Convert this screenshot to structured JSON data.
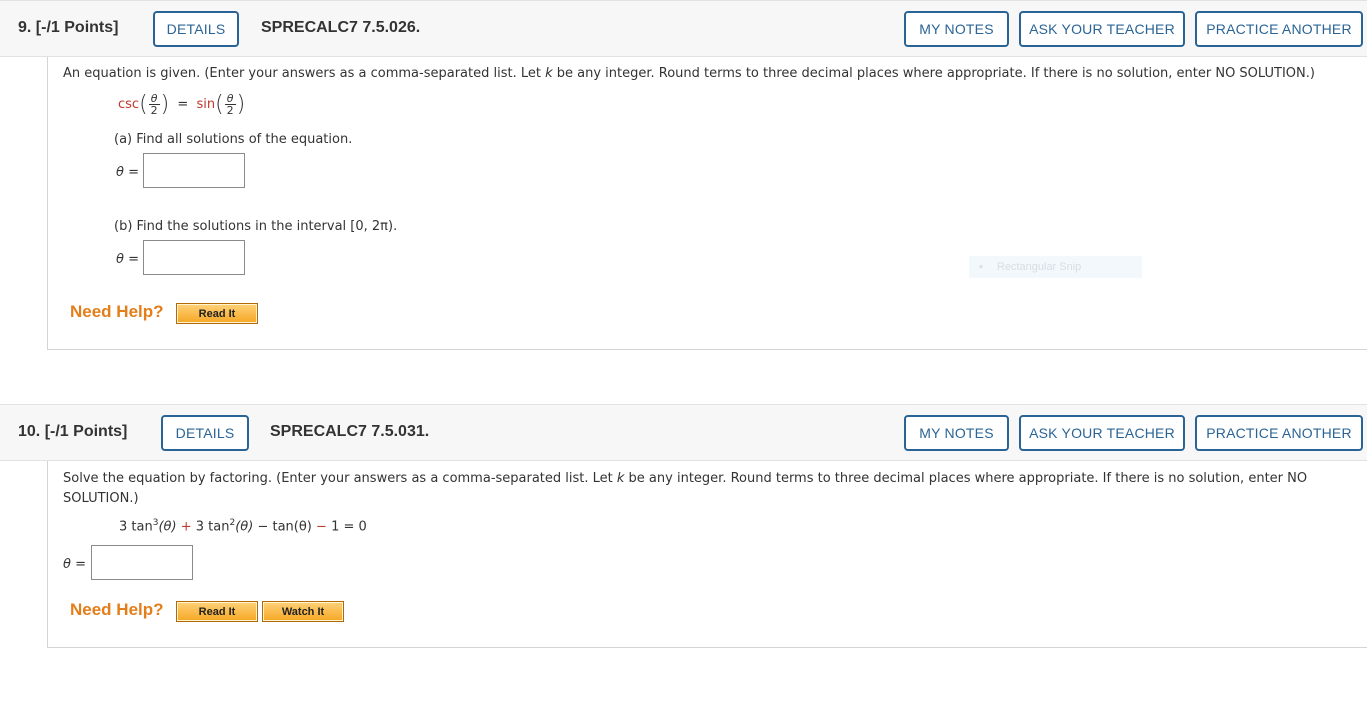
{
  "questions": [
    {
      "number": "9.",
      "points": "[-/1 Points]",
      "details_label": "DETAILS",
      "code": "SPRECALC7 7.5.026.",
      "buttons": {
        "my_notes": "MY NOTES",
        "ask_teacher": "ASK YOUR TEACHER",
        "practice": "PRACTICE ANOTHER"
      },
      "instructions_pre": "An equation is given. (Enter your answers as a comma-separated list. Let ",
      "instructions_var": "k",
      "instructions_post": " be any integer. Round terms to three decimal places where appropriate. If there is no solution, enter NO SOLUTION.)",
      "equation": {
        "left_fn": "csc",
        "right_fn": "sin",
        "equals": "=",
        "numerator": "θ",
        "denominator": "2"
      },
      "part_a": {
        "prompt": "(a) Find all solutions of the equation.",
        "label": "θ =",
        "value": ""
      },
      "part_b": {
        "prompt": "(b) Find the solutions in the interval [0, 2π).",
        "label": "θ =",
        "value": ""
      },
      "need_help": "Need Help?",
      "help_buttons": [
        "Read It"
      ]
    },
    {
      "number": "10.",
      "points": "[-/1 Points]",
      "details_label": "DETAILS",
      "code": "SPRECALC7 7.5.031.",
      "buttons": {
        "my_notes": "MY NOTES",
        "ask_teacher": "ASK YOUR TEACHER",
        "practice": "PRACTICE ANOTHER"
      },
      "instructions_line1_pre": "Solve the equation by factoring. (Enter your answers as a comma-separated list. Let ",
      "instructions_var": "k",
      "instructions_line1_post": " be any integer. Round terms to three decimal places where appropriate. If there is no solution, enter NO",
      "instructions_line2": "SOLUTION.)",
      "equation": {
        "t1_coef": "3 tan",
        "t1_exp": "3",
        "t1_arg": "(θ)",
        "plus": "+",
        "t2_coef": "3 tan",
        "t2_exp": "2",
        "t2_arg": "(θ)",
        "t3": "− tan(θ)",
        "minus": "−",
        "rhs": "1 = 0"
      },
      "answer": {
        "label": "θ =",
        "value": ""
      },
      "need_help": "Need Help?",
      "help_buttons": [
        "Read It",
        "Watch It"
      ]
    }
  ],
  "overlay_hint": "Rectangular Snip",
  "colors": {
    "accent": "#2a6496",
    "help_orange": "#e37e1a",
    "function_red": "#c0392b"
  }
}
